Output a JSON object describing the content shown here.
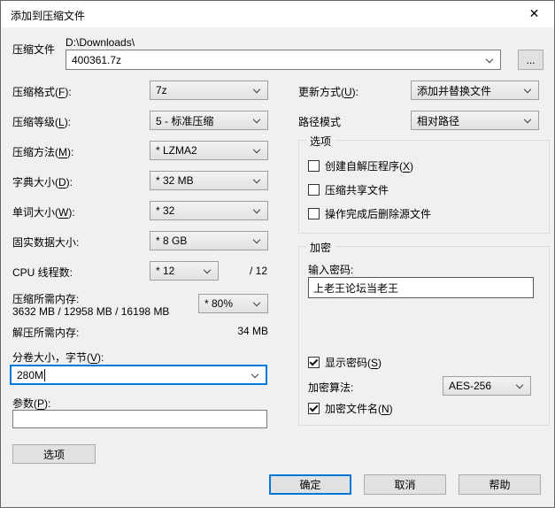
{
  "colors": {
    "accent": "#0078d7",
    "dialog_bg": "#f0f0f0",
    "titlebar_bg": "#ffffff",
    "combo_border": "#9f9f9f"
  },
  "icons": {
    "close": "✕",
    "browse": "...",
    "chevron": "chevron-down"
  },
  "window": {
    "title": "添加到压缩文件"
  },
  "archive": {
    "label": "压缩文件",
    "dir": "D:\\Downloads\\",
    "name": "400361.7z"
  },
  "left": {
    "format": {
      "pre": "压缩格式(",
      "key": "F",
      "post": "):",
      "value": "7z"
    },
    "level": {
      "pre": "压缩等级(",
      "key": "L",
      "post": "):",
      "value": "5 - 标准压缩"
    },
    "method": {
      "pre": "压缩方法(",
      "key": "M",
      "post": "):",
      "value": "* LZMA2"
    },
    "dict": {
      "pre": "字典大小(",
      "key": "D",
      "post": "):",
      "value": "* 32 MB"
    },
    "word": {
      "pre": "单词大小(",
      "key": "W",
      "post": "):",
      "value": "* 32"
    },
    "solid": {
      "label": "固实数据大小:",
      "value": "* 8 GB"
    },
    "threads": {
      "label": "CPU 线程数:",
      "value": "* 12",
      "max": "/ 12"
    },
    "mem_compress": {
      "label": "压缩所需内存:",
      "detail": "3632 MB / 12958 MB / 16198 MB",
      "value": "* 80%"
    },
    "mem_decompress": {
      "label": "解压所需内存:",
      "value": "34 MB"
    },
    "volume": {
      "pre": "分卷大小，字节(",
      "key": "V",
      "post": "):",
      "value": "280M"
    },
    "params": {
      "pre": "参数(",
      "key": "P",
      "post": "):",
      "value": ""
    },
    "options_button": "选项"
  },
  "right": {
    "update": {
      "pre": "更新方式(",
      "key": "U",
      "post": "):",
      "value": "添加并替换文件"
    },
    "path_mode": {
      "label": "路径模式",
      "value": "相对路径"
    },
    "options_group": {
      "title": "选项",
      "sfx": {
        "pre": "创建自解压程序(",
        "key": "X",
        "post": ")",
        "checked": false
      },
      "shared": {
        "pre": "压缩共享文件",
        "key": "",
        "post": "",
        "checked": false
      },
      "delete_after": {
        "pre": "操作完成后删除源文件",
        "key": "",
        "post": "",
        "checked": false
      }
    },
    "encryption_group": {
      "title": "加密",
      "password_label": "输入密码:",
      "password_value": "上老王论坛当老王",
      "show_password": {
        "pre": "显示密码(",
        "key": "S",
        "post": ")",
        "checked": true
      },
      "method_label": "加密算法:",
      "method_value": "AES-256",
      "encrypt_names": {
        "pre": "加密文件名(",
        "key": "N",
        "post": ")",
        "checked": true
      }
    }
  },
  "footer": {
    "ok": "确定",
    "cancel": "取消",
    "help": "帮助"
  }
}
